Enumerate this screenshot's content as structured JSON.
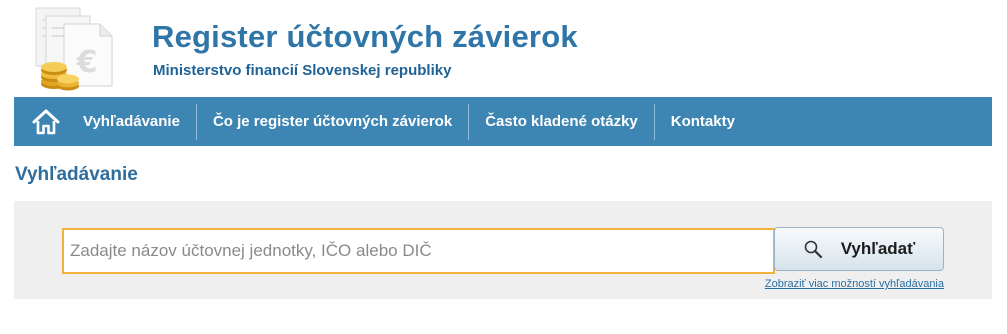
{
  "header": {
    "title": "Register účtovných závierok",
    "subtitle": "Ministerstvo financií Slovenskej republiky",
    "logo_icon": "documents-euro-coins-icon"
  },
  "nav": {
    "home_icon": "home-icon",
    "items": [
      {
        "label": "Vyhľadávanie"
      },
      {
        "label": "Čo je register účtovných závierok"
      },
      {
        "label": "Často kladené otázky"
      },
      {
        "label": "Kontakty"
      }
    ],
    "background_color": "#3d85b2"
  },
  "main": {
    "heading": "Vyhľadávanie",
    "search": {
      "placeholder": "Zadajte názov účtovnej jednotky, IČO alebo DIČ",
      "value": "",
      "button_label": "Vyhľadať",
      "button_icon": "magnifier-icon",
      "more_options_link": "Zobraziť viac možností vyhľadávania"
    }
  },
  "colors": {
    "title": "#2f75a8",
    "input_border": "#f0b33c"
  }
}
